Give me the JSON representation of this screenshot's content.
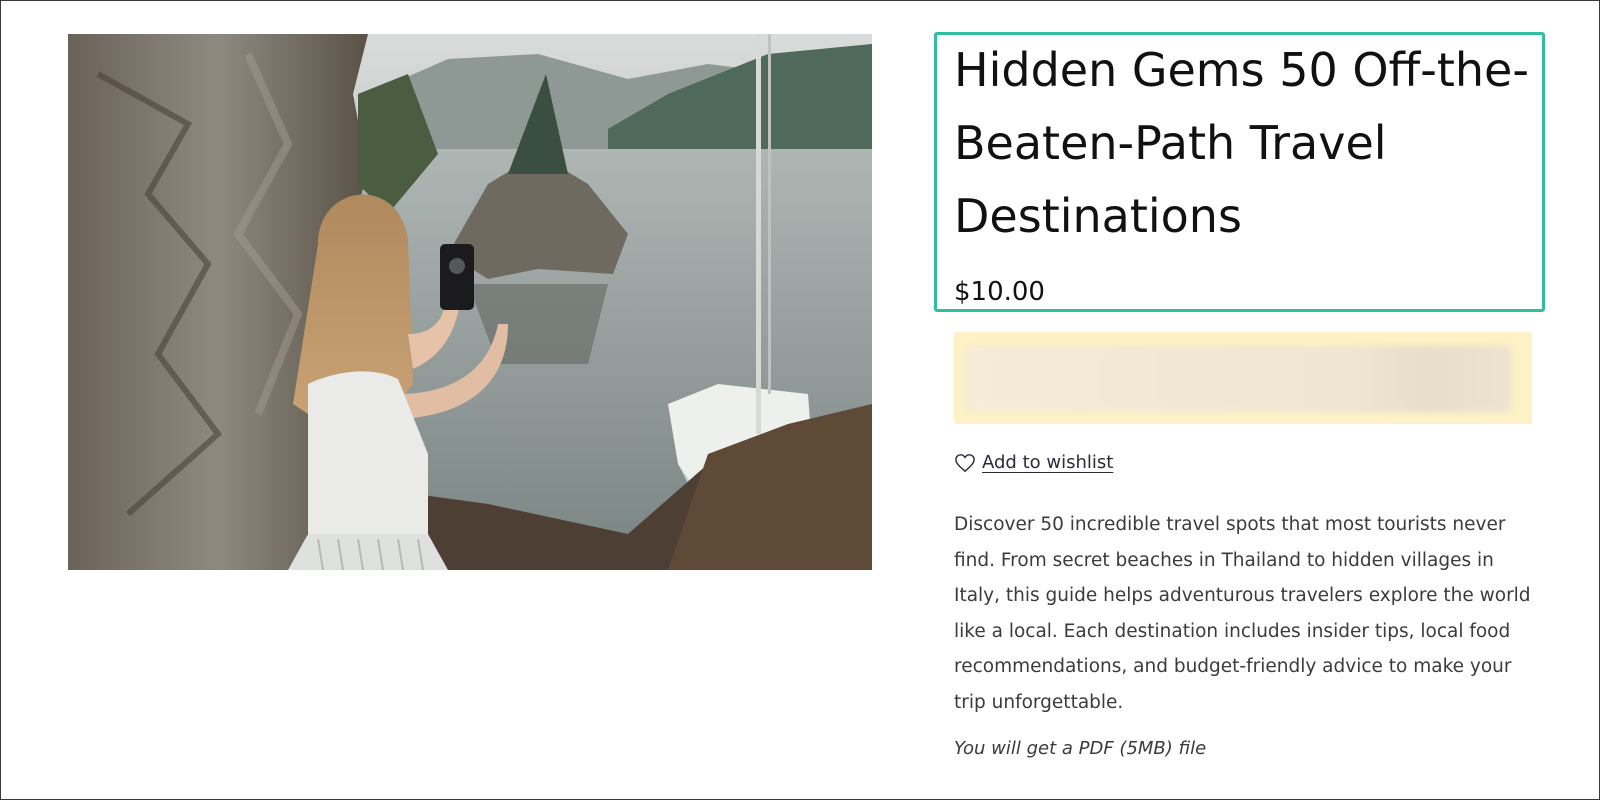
{
  "product": {
    "image_alt": "Woman photographing a lake with a sailboat",
    "title": "Hidden Gems 50 Off-the-Beaten-Path Travel Destinations",
    "price": "$10.00",
    "wishlist_label": "Add to wishlist",
    "description": "Discover 50 incredible travel spots that most tourists never find. From secret beaches in Thailand to hidden villages in Italy, this guide helps adventurous travelers explore the world like a local. Each destination includes insider tips, local food recommendations, and budget-friendly advice to make your trip unforgettable.",
    "file_note": "You will get a PDF (5MB) file"
  },
  "icons": {
    "wishlist": "heart-outline-icon"
  },
  "colors": {
    "highlight_border": "#2fbfa0",
    "notice_background": "#fdf1c6",
    "text": "#111111"
  }
}
